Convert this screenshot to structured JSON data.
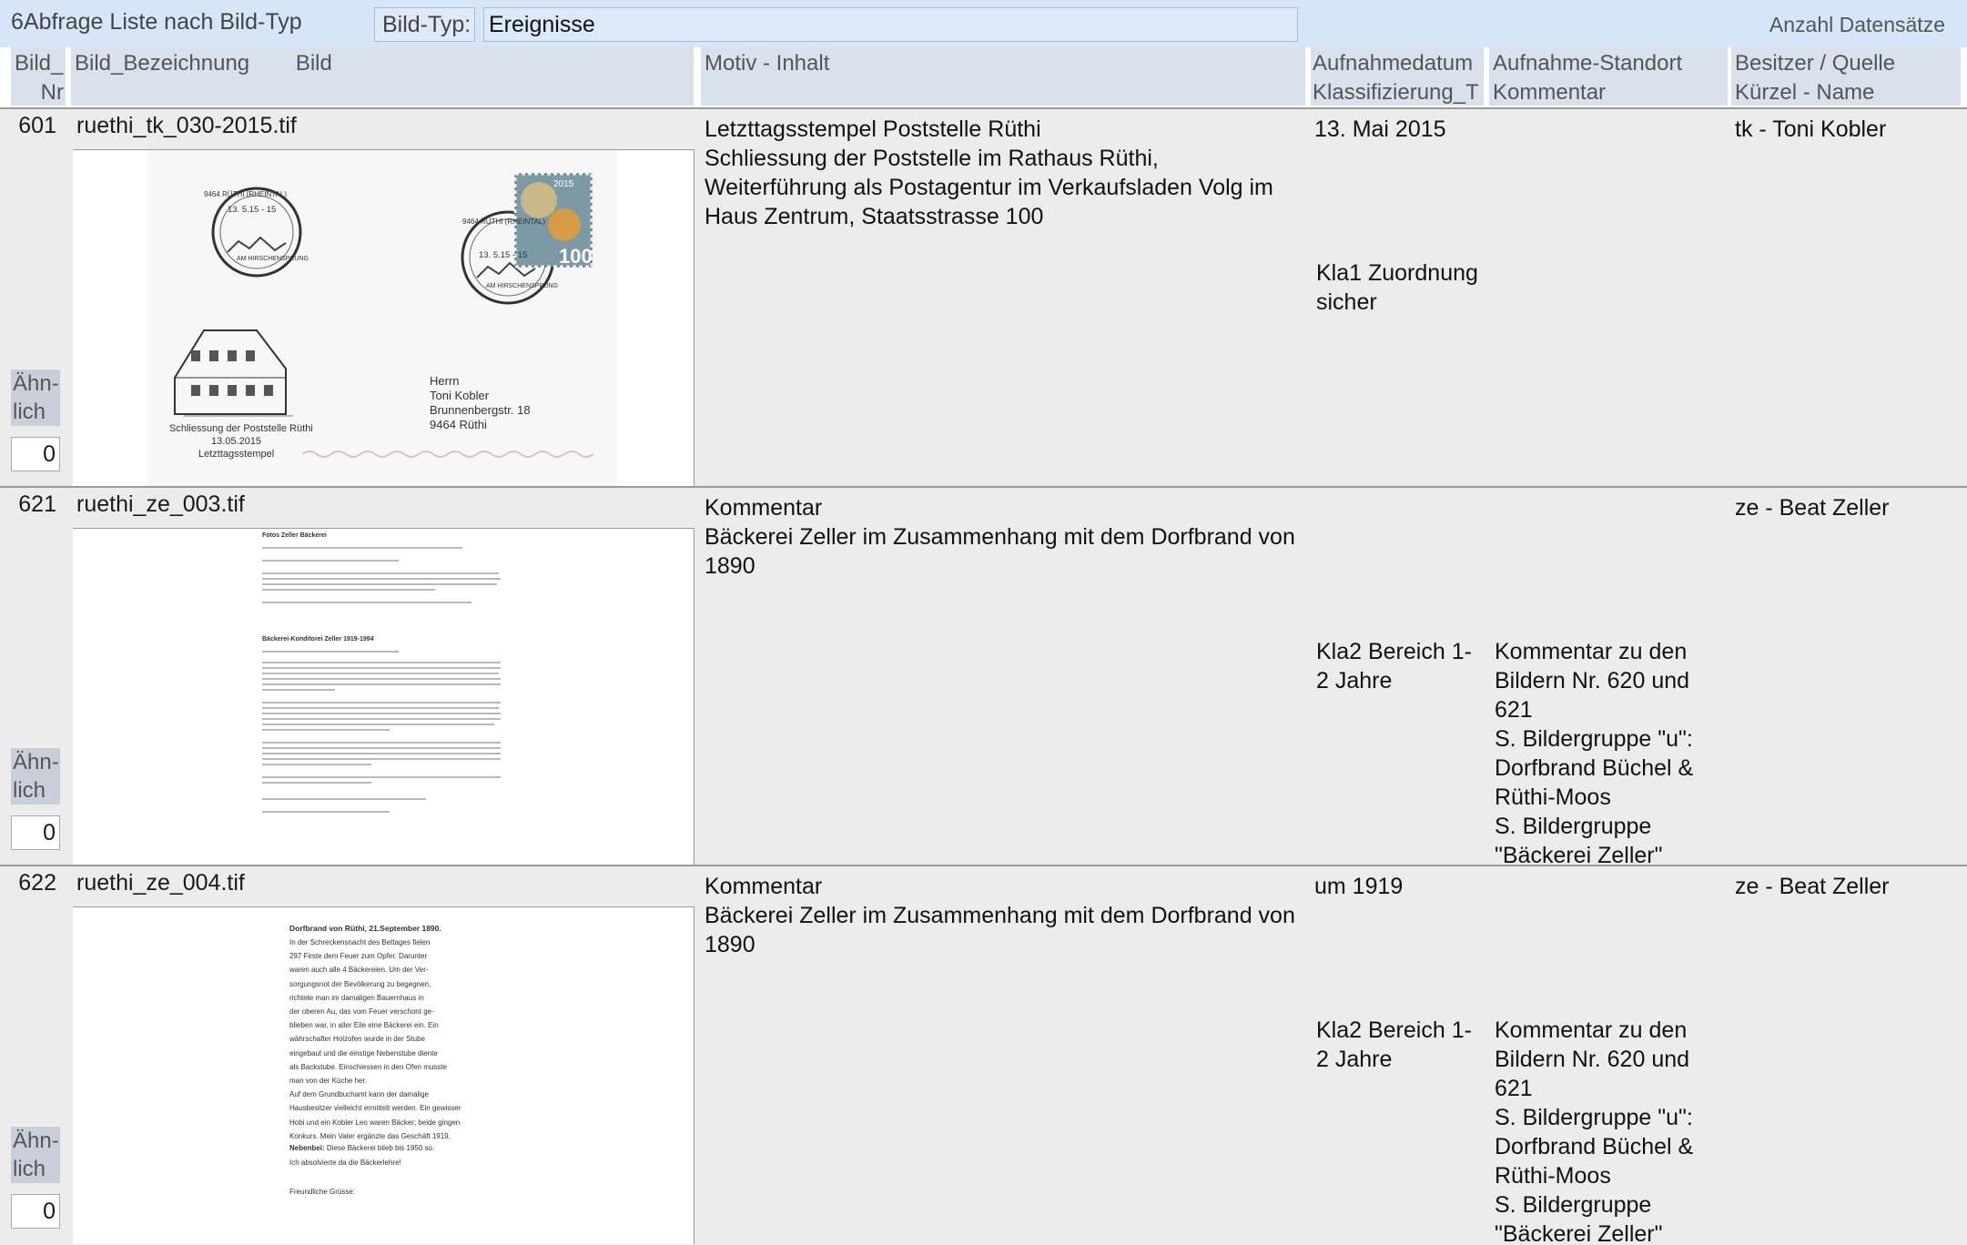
{
  "form": {
    "title": "6Abfrage Liste nach Bild-Typ",
    "filter_label": "Bild-Typ:",
    "filter_value": "Ereignisse",
    "count_label": "Anzahl Datensätze"
  },
  "header": {
    "bild_nr_line1": "Bild_",
    "bild_nr_line2": "Nr",
    "bezeichnung": "Bild_Bezeichnung",
    "bild": "Bild",
    "motiv": "Motiv - Inhalt",
    "datum_line1": "Aufnahmedatum",
    "datum_line2": "Klassifizierung_T",
    "standort_line1": "Aufnahme-Standort",
    "standort_line2": "Kommentar",
    "besitzer_line1": "Besitzer / Quelle",
    "besitzer_line2": "Kürzel - Name"
  },
  "records": [
    {
      "nr": "601",
      "name": "ruethi_tk_030-2015.tif",
      "motiv_title": "Letzttagsstempel Poststelle Rüthi",
      "motiv_text": "Schliessung der Poststelle im Rathaus Rüthi, Weiterführung als Postagentur im Verkaufsladen Volg im Haus Zentrum, Staatsstrasse 100",
      "datum": "13. Mai 2015",
      "klassifizierung": "Kla1 Zuordnung sicher",
      "kommentar": "",
      "besitzer": "tk - Toni Kobler",
      "aehnlich_label": "Ähn-lich",
      "aehnlich_value": "0",
      "envelope": {
        "stamp_text": "9464 RÜTHI (RHEINTAL)",
        "stamp_date": "13. 5.15 - 15",
        "stamp_sub": "AM HIRSCHENSPRUNG",
        "stamp_value": "100",
        "stamp_year": "2015",
        "caption_1": "Schliessung der Poststelle Rüthi",
        "caption_2": "13.05.2015",
        "caption_3": "Letzttagsstempel",
        "addr_1": "Herrn",
        "addr_2": "Toni Kobler",
        "addr_3": "Brunnenbergstr. 18",
        "addr_4": "9464  Rüthi"
      }
    },
    {
      "nr": "621",
      "name": "ruethi_ze_003.tif",
      "motiv_title": "Kommentar",
      "motiv_text": "Bäckerei Zeller im Zusammenhang mit dem Dorfbrand von 1890",
      "datum": "",
      "klassifizierung": "Kla2 Bereich 1-2 Jahre",
      "kommentar": "Kommentar zu den Bildern Nr. 620 und 621\nS. Bildergruppe \"u\": Dorfbrand Büchel & Rüthi-Moos\nS. Bildergruppe \"Bäckerei Zeller\"",
      "besitzer": "ze - Beat Zeller",
      "aehnlich_label": "Ähn-lich",
      "aehnlich_value": "0",
      "doc": {
        "heading_1": "Fotos Zeller Bäckerei",
        "heading_2": "Bäckerei-Konditorei Zeller 1919-1994"
      }
    },
    {
      "nr": "622",
      "name": "ruethi_ze_004.tif",
      "motiv_title": "Kommentar",
      "motiv_text": "Bäckerei Zeller im Zusammenhang mit dem Dorfbrand von 1890",
      "datum": "um 1919",
      "klassifizierung": "Kla2 Bereich 1-2 Jahre",
      "kommentar": "Kommentar zu den Bildern Nr. 620 und 621\nS. Bildergruppe \"u\": Dorfbrand Büchel & Rüthi-Moos\nS. Bildergruppe \"Bäckerei Zeller\"",
      "besitzer": "ze - Beat Zeller",
      "aehnlich_label": "Ähn-lich",
      "aehnlich_value": "0",
      "letter": {
        "title": "Dorfbrand von Rüthi, 21.September 1890.",
        "lines": [
          "In der Schreckensnacht des Bettages fielen",
          "297 Firste dem Feuer zum Opfer. Darunter",
          "waren auch alle 4 Bäckereien. Um der Ver-",
          "sorgungsnot der Bevölkerung zu begegnen,",
          "richtete man im damaligen Bauernhaus in",
          "der oberen Au, das vom Feuer verschont ge-",
          "blieben war, in aller Eile eine Bäckerei ein. Ein",
          "währschafter Holzofen wurde in der Stube",
          "eingebaut und die einstige Nebenstube diente",
          "als Backstube. Einschiessen in den Ofen musste",
          "man von der Küche her.",
          "Auf dem Grundbuchamt kann der damalige",
          "Hausbesitzer vielleicht ermittelt werden. Ein gewisser",
          "Hobi und ein Kobler Leo waren Bäcker; beide gingen",
          "Konkurs. Mein Vater ergänzte das Geschäft 1919."
        ],
        "nebenbei_label": "Nebenbei:",
        "nebenbei_text": "Diese Bäckerei blieb bis 1950 so.",
        "closing_1": "Ich absolvierte da die Bäckerlehre!",
        "closing_2": "Freundliche Grüsse:"
      }
    }
  ]
}
